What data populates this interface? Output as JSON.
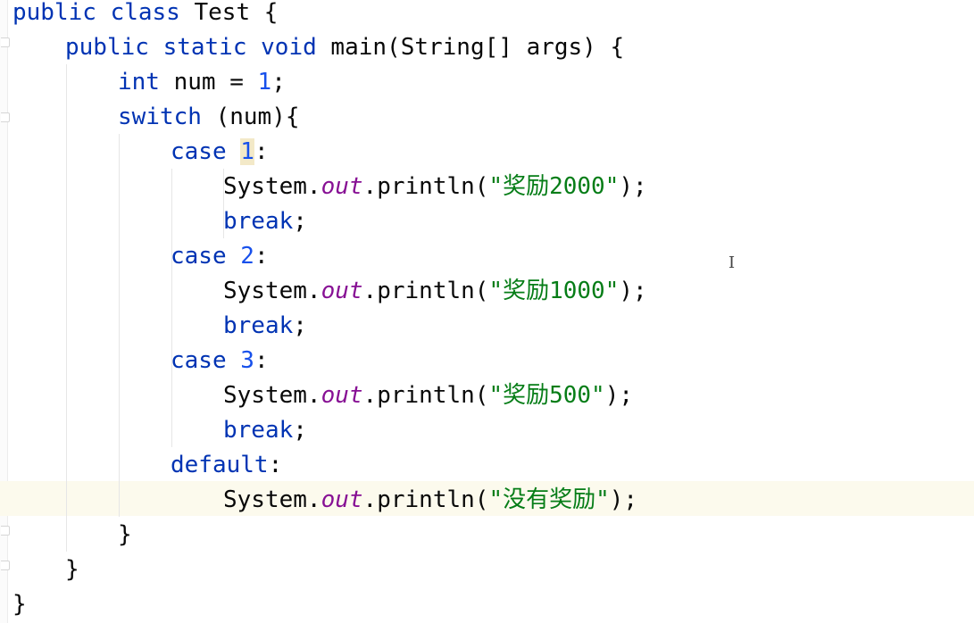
{
  "editor": {
    "lines": [
      {
        "id": "l1",
        "tokens": [
          {
            "t": "kw",
            "v": "public class "
          },
          {
            "t": "plain",
            "v": "Test {"
          }
        ]
      },
      {
        "id": "l2",
        "tokens": [
          {
            "t": "kw",
            "v": "public static void "
          },
          {
            "t": "plain",
            "v": "main(String[] args) {"
          }
        ]
      },
      {
        "id": "l3",
        "tokens": [
          {
            "t": "kw",
            "v": "int "
          },
          {
            "t": "plain",
            "v": "num = "
          },
          {
            "t": "num",
            "v": "1"
          },
          {
            "t": "plain",
            "v": ";"
          }
        ]
      },
      {
        "id": "l4",
        "tokens": [
          {
            "t": "kw",
            "v": "switch "
          },
          {
            "t": "plain",
            "v": "(num){"
          }
        ]
      },
      {
        "id": "l5",
        "tokens": [
          {
            "t": "kw",
            "v": "case "
          },
          {
            "t": "num",
            "v": "1"
          },
          {
            "t": "plain",
            "v": ":"
          }
        ]
      },
      {
        "id": "l6",
        "tokens": [
          {
            "t": "plain",
            "v": "System."
          },
          {
            "t": "fld",
            "v": "out"
          },
          {
            "t": "plain",
            "v": ".println("
          },
          {
            "t": "str",
            "v": "\"奖励2000\""
          },
          {
            "t": "plain",
            "v": ");"
          }
        ]
      },
      {
        "id": "l7",
        "tokens": [
          {
            "t": "kw",
            "v": "break"
          },
          {
            "t": "plain",
            "v": ";"
          }
        ]
      },
      {
        "id": "l8",
        "tokens": [
          {
            "t": "kw",
            "v": "case "
          },
          {
            "t": "num",
            "v": "2"
          },
          {
            "t": "plain",
            "v": ":"
          }
        ]
      },
      {
        "id": "l9",
        "tokens": [
          {
            "t": "plain",
            "v": "System."
          },
          {
            "t": "fld",
            "v": "out"
          },
          {
            "t": "plain",
            "v": ".println("
          },
          {
            "t": "str",
            "v": "\"奖励1000\""
          },
          {
            "t": "plain",
            "v": ");"
          }
        ]
      },
      {
        "id": "l10",
        "tokens": [
          {
            "t": "kw",
            "v": "break"
          },
          {
            "t": "plain",
            "v": ";"
          }
        ]
      },
      {
        "id": "l11",
        "tokens": [
          {
            "t": "kw",
            "v": "case "
          },
          {
            "t": "num",
            "v": "3"
          },
          {
            "t": "plain",
            "v": ":"
          }
        ]
      },
      {
        "id": "l12",
        "tokens": [
          {
            "t": "plain",
            "v": "System."
          },
          {
            "t": "fld",
            "v": "out"
          },
          {
            "t": "plain",
            "v": ".println("
          },
          {
            "t": "str",
            "v": "\"奖励500\""
          },
          {
            "t": "plain",
            "v": ");"
          }
        ]
      },
      {
        "id": "l13",
        "tokens": [
          {
            "t": "kw",
            "v": "break"
          },
          {
            "t": "plain",
            "v": ";"
          }
        ]
      },
      {
        "id": "l14",
        "tokens": [
          {
            "t": "kw",
            "v": "default"
          },
          {
            "t": "plain",
            "v": ":"
          }
        ]
      },
      {
        "id": "l15",
        "tokens": [
          {
            "t": "plain",
            "v": "System."
          },
          {
            "t": "fld",
            "v": "out"
          },
          {
            "t": "plain",
            "v": ".println("
          },
          {
            "t": "str",
            "v": "\"没有奖励\""
          },
          {
            "t": "plain",
            "v": ");"
          }
        ]
      },
      {
        "id": "l16",
        "tokens": [
          {
            "t": "plain",
            "v": "}"
          }
        ]
      },
      {
        "id": "l17",
        "tokens": [
          {
            "t": "plain",
            "v": "}"
          }
        ]
      },
      {
        "id": "l18",
        "tokens": [
          {
            "t": "plain",
            "v": "}"
          }
        ]
      }
    ],
    "highlighted_token": {
      "line": "l5",
      "value": "1"
    },
    "current_line": "l15",
    "cursor_icon": "text-cursor-icon"
  },
  "colors": {
    "keyword": "#0033b3",
    "number": "#1750eb",
    "string": "#067d17",
    "field": "#871094",
    "text": "#080808",
    "current_line_bg": "#fcfaed",
    "match_highlight": "#f3e9c8"
  }
}
